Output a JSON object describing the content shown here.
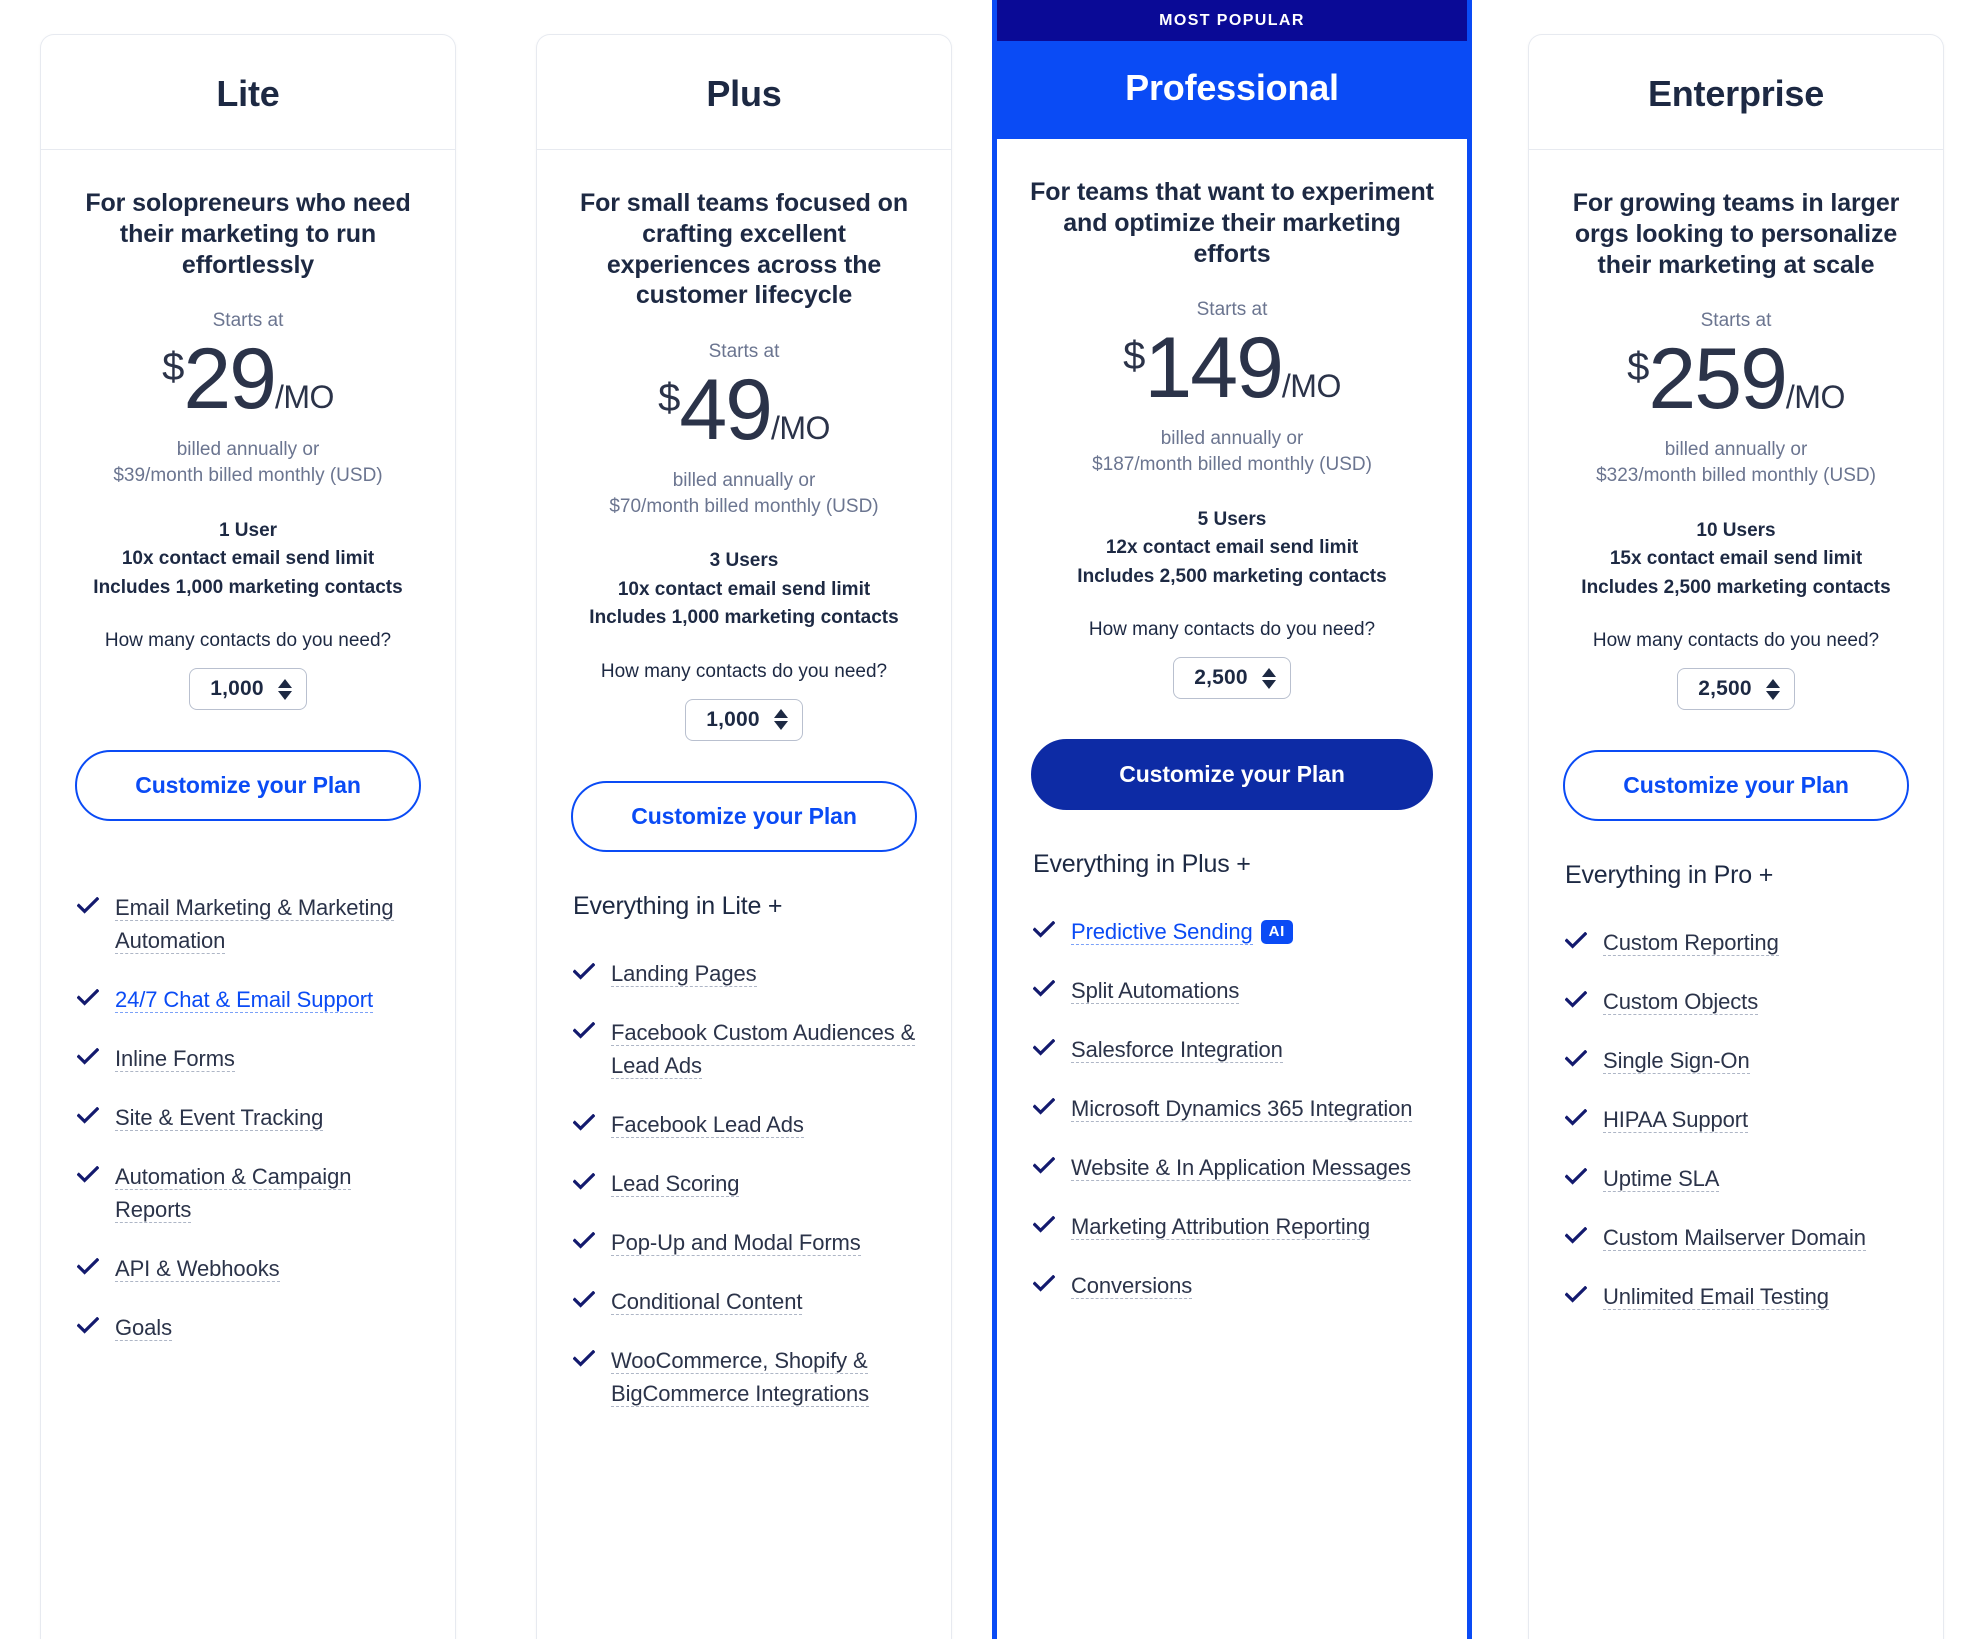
{
  "colors": {
    "accent_blue": "#0a4bf5",
    "deep_navy": "#0a0a96",
    "button_navy": "#0d2ba5",
    "text_dark": "#1d2943",
    "text_muted": "#6b7590"
  },
  "common": {
    "starts_at_label": "Starts at",
    "currency_symbol": "$",
    "period_label": "/MO",
    "contacts_question": "How many contacts do you need?",
    "cta_label": "Customize your Plan",
    "check_icon": "check-icon",
    "stepper_up_icon": "arrow-up-icon",
    "stepper_down_icon": "arrow-down-icon"
  },
  "plans": [
    {
      "name": "Lite",
      "featured": false,
      "badge": "",
      "tagline": "For solopreneurs who need their marketing to run effortlessly",
      "price": "29",
      "billing_line1": "billed annually or",
      "billing_line2": "$39/month billed monthly (USD)",
      "users": "1 User",
      "send_limit": "10x contact email send limit",
      "contacts_included": "Includes 1,000 marketing contacts",
      "contacts_value": "1,000",
      "everything_in": "",
      "features": [
        {
          "label": "Email Marketing & Marketing Automation",
          "link": false,
          "badge": ""
        },
        {
          "label": "24/7 Chat & Email Support",
          "link": true,
          "badge": ""
        },
        {
          "label": "Inline Forms",
          "link": false,
          "badge": ""
        },
        {
          "label": "Site & Event Tracking",
          "link": false,
          "badge": ""
        },
        {
          "label": "Automation & Campaign Reports",
          "link": false,
          "badge": ""
        },
        {
          "label": "API & Webhooks",
          "link": false,
          "badge": ""
        },
        {
          "label": "Goals",
          "link": false,
          "badge": ""
        }
      ]
    },
    {
      "name": "Plus",
      "featured": false,
      "badge": "",
      "tagline": "For small teams focused on crafting excellent experiences across the customer lifecycle",
      "price": "49",
      "billing_line1": "billed annually or",
      "billing_line2": "$70/month billed monthly (USD)",
      "users": "3 Users",
      "send_limit": "10x contact email send limit",
      "contacts_included": "Includes 1,000 marketing contacts",
      "contacts_value": "1,000",
      "everything_in": "Everything in Lite +",
      "features": [
        {
          "label": "Landing Pages",
          "link": false,
          "badge": ""
        },
        {
          "label": "Facebook Custom Audiences & Lead Ads",
          "link": false,
          "badge": ""
        },
        {
          "label": "Facebook Lead Ads",
          "link": false,
          "badge": ""
        },
        {
          "label": "Lead Scoring",
          "link": false,
          "badge": ""
        },
        {
          "label": "Pop-Up and Modal Forms",
          "link": false,
          "badge": ""
        },
        {
          "label": "Conditional Content",
          "link": false,
          "badge": ""
        },
        {
          "label": "WooCommerce, Shopify & BigCommerce Integrations",
          "link": false,
          "badge": ""
        }
      ]
    },
    {
      "name": "Professional",
      "featured": true,
      "badge": "MOST POPULAR",
      "tagline": "For teams that want to experiment and optimize their marketing efforts",
      "price": "149",
      "billing_line1": "billed annually or",
      "billing_line2": "$187/month billed monthly (USD)",
      "users": "5 Users",
      "send_limit": "12x contact email send limit",
      "contacts_included": "Includes 2,500 marketing contacts",
      "contacts_value": "2,500",
      "everything_in": "Everything in Plus +",
      "features": [
        {
          "label": "Predictive Sending",
          "link": true,
          "badge": "AI"
        },
        {
          "label": "Split Automations",
          "link": false,
          "badge": ""
        },
        {
          "label": "Salesforce Integration",
          "link": false,
          "badge": ""
        },
        {
          "label": "Microsoft Dynamics 365 Integration",
          "link": false,
          "badge": ""
        },
        {
          "label": "Website & In Application Messages",
          "link": false,
          "badge": ""
        },
        {
          "label": "Marketing Attribution Reporting",
          "link": false,
          "badge": ""
        },
        {
          "label": "Conversions",
          "link": false,
          "badge": ""
        }
      ]
    },
    {
      "name": "Enterprise",
      "featured": false,
      "badge": "",
      "tagline": "For growing teams in larger orgs looking to personalize their marketing at scale",
      "price": "259",
      "billing_line1": "billed annually or",
      "billing_line2": "$323/month billed monthly (USD)",
      "users": "10 Users",
      "send_limit": "15x contact email send limit",
      "contacts_included": "Includes 2,500 marketing contacts",
      "contacts_value": "2,500",
      "everything_in": "Everything in Pro +",
      "features": [
        {
          "label": "Custom Reporting",
          "link": false,
          "badge": ""
        },
        {
          "label": "Custom Objects",
          "link": false,
          "badge": ""
        },
        {
          "label": "Single Sign-On",
          "link": false,
          "badge": ""
        },
        {
          "label": "HIPAA Support",
          "link": false,
          "badge": ""
        },
        {
          "label": "Uptime SLA",
          "link": false,
          "badge": ""
        },
        {
          "label": "Custom Mailserver Domain",
          "link": false,
          "badge": ""
        },
        {
          "label": "Unlimited Email Testing",
          "link": false,
          "badge": ""
        }
      ]
    }
  ]
}
